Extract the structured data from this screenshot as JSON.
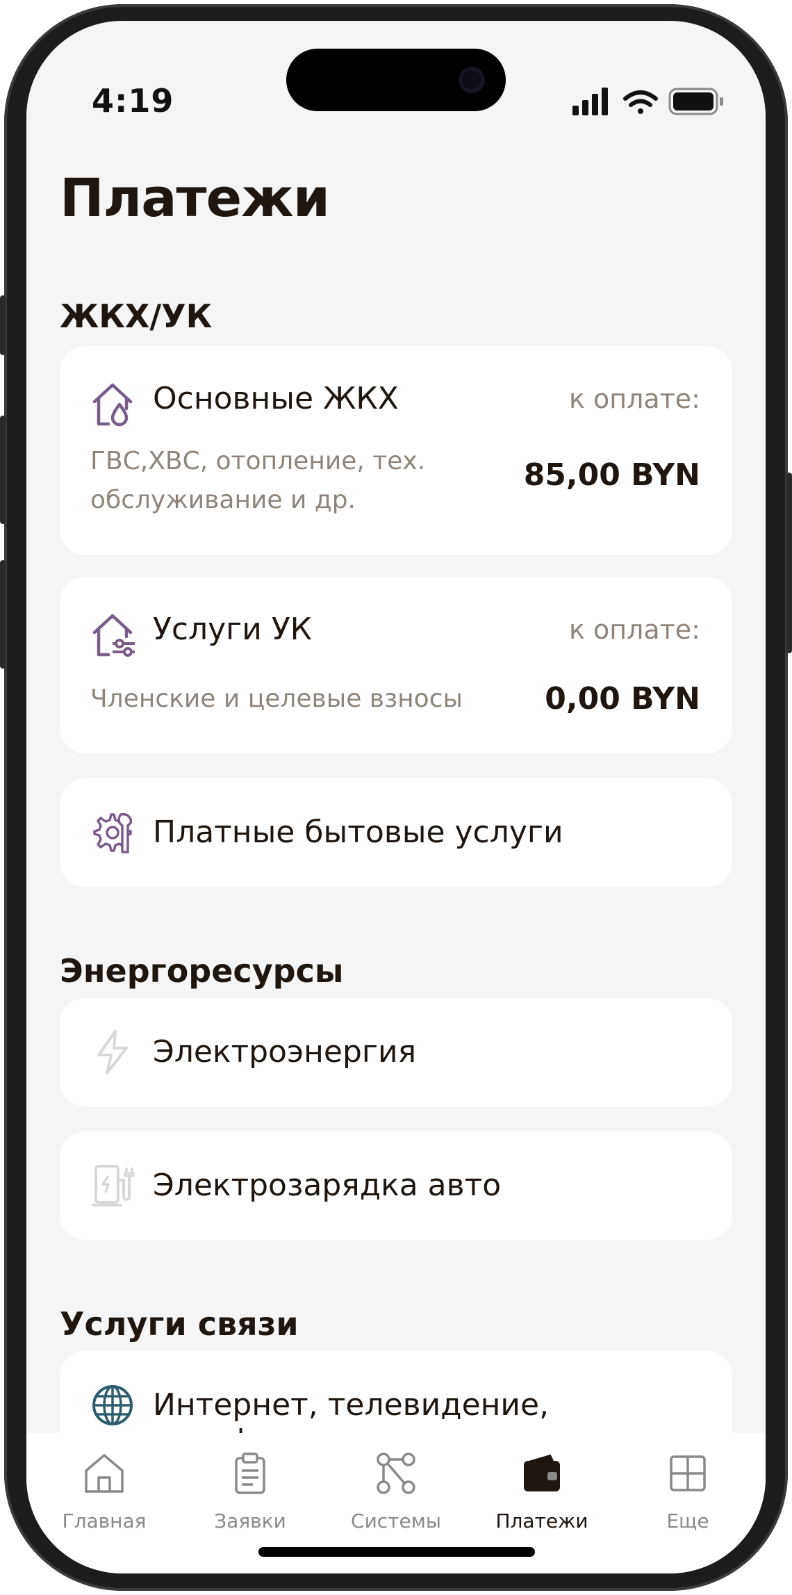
{
  "status_bar": {
    "time": "4:19"
  },
  "page": {
    "title": "Платежи"
  },
  "sections": [
    {
      "title": "ЖКХ/УК"
    },
    {
      "title": "Энергоресурсы"
    },
    {
      "title": "Услуги связи"
    }
  ],
  "cards": {
    "housing": {
      "title": "Основные ЖКХ",
      "subtitle_line1": "ГВС,ХВС, отопление, тех.",
      "subtitle_line2": "обслуживание и др.",
      "due_label": "к оплате:",
      "amount": "85,00 BYN",
      "icon": "house-drop-icon"
    },
    "management": {
      "title": "Услуги УК",
      "subtitle": "Членские и целевые взносы",
      "due_label": "к оплате:",
      "amount": "0,00 BYN",
      "icon": "house-settings-icon"
    },
    "household": {
      "title": "Платные бытовые услуги",
      "icon": "gear-wrench-icon"
    },
    "electricity": {
      "title": "Электроэнергия",
      "icon": "lightning-icon"
    },
    "ev_charging": {
      "title": "Электрозарядка авто",
      "icon": "ev-charger-icon"
    },
    "internet": {
      "title": "Интернет, телевидение, телефония",
      "icon": "globe-icon"
    }
  },
  "tabbar": {
    "items": [
      {
        "label": "Главная",
        "icon": "home-icon"
      },
      {
        "label": "Заявки",
        "icon": "clipboard-icon"
      },
      {
        "label": "Системы",
        "icon": "nodes-icon"
      },
      {
        "label": "Платежи",
        "icon": "wallet-icon",
        "active": true
      },
      {
        "label": "Еще",
        "icon": "grid-icon"
      }
    ]
  },
  "colors": {
    "accent_icon": "#7a5c8a",
    "faded_icon": "#d8d8d8",
    "text_primary": "#1e160f",
    "text_secondary": "#8f857b",
    "background": "#f5f5f5"
  }
}
